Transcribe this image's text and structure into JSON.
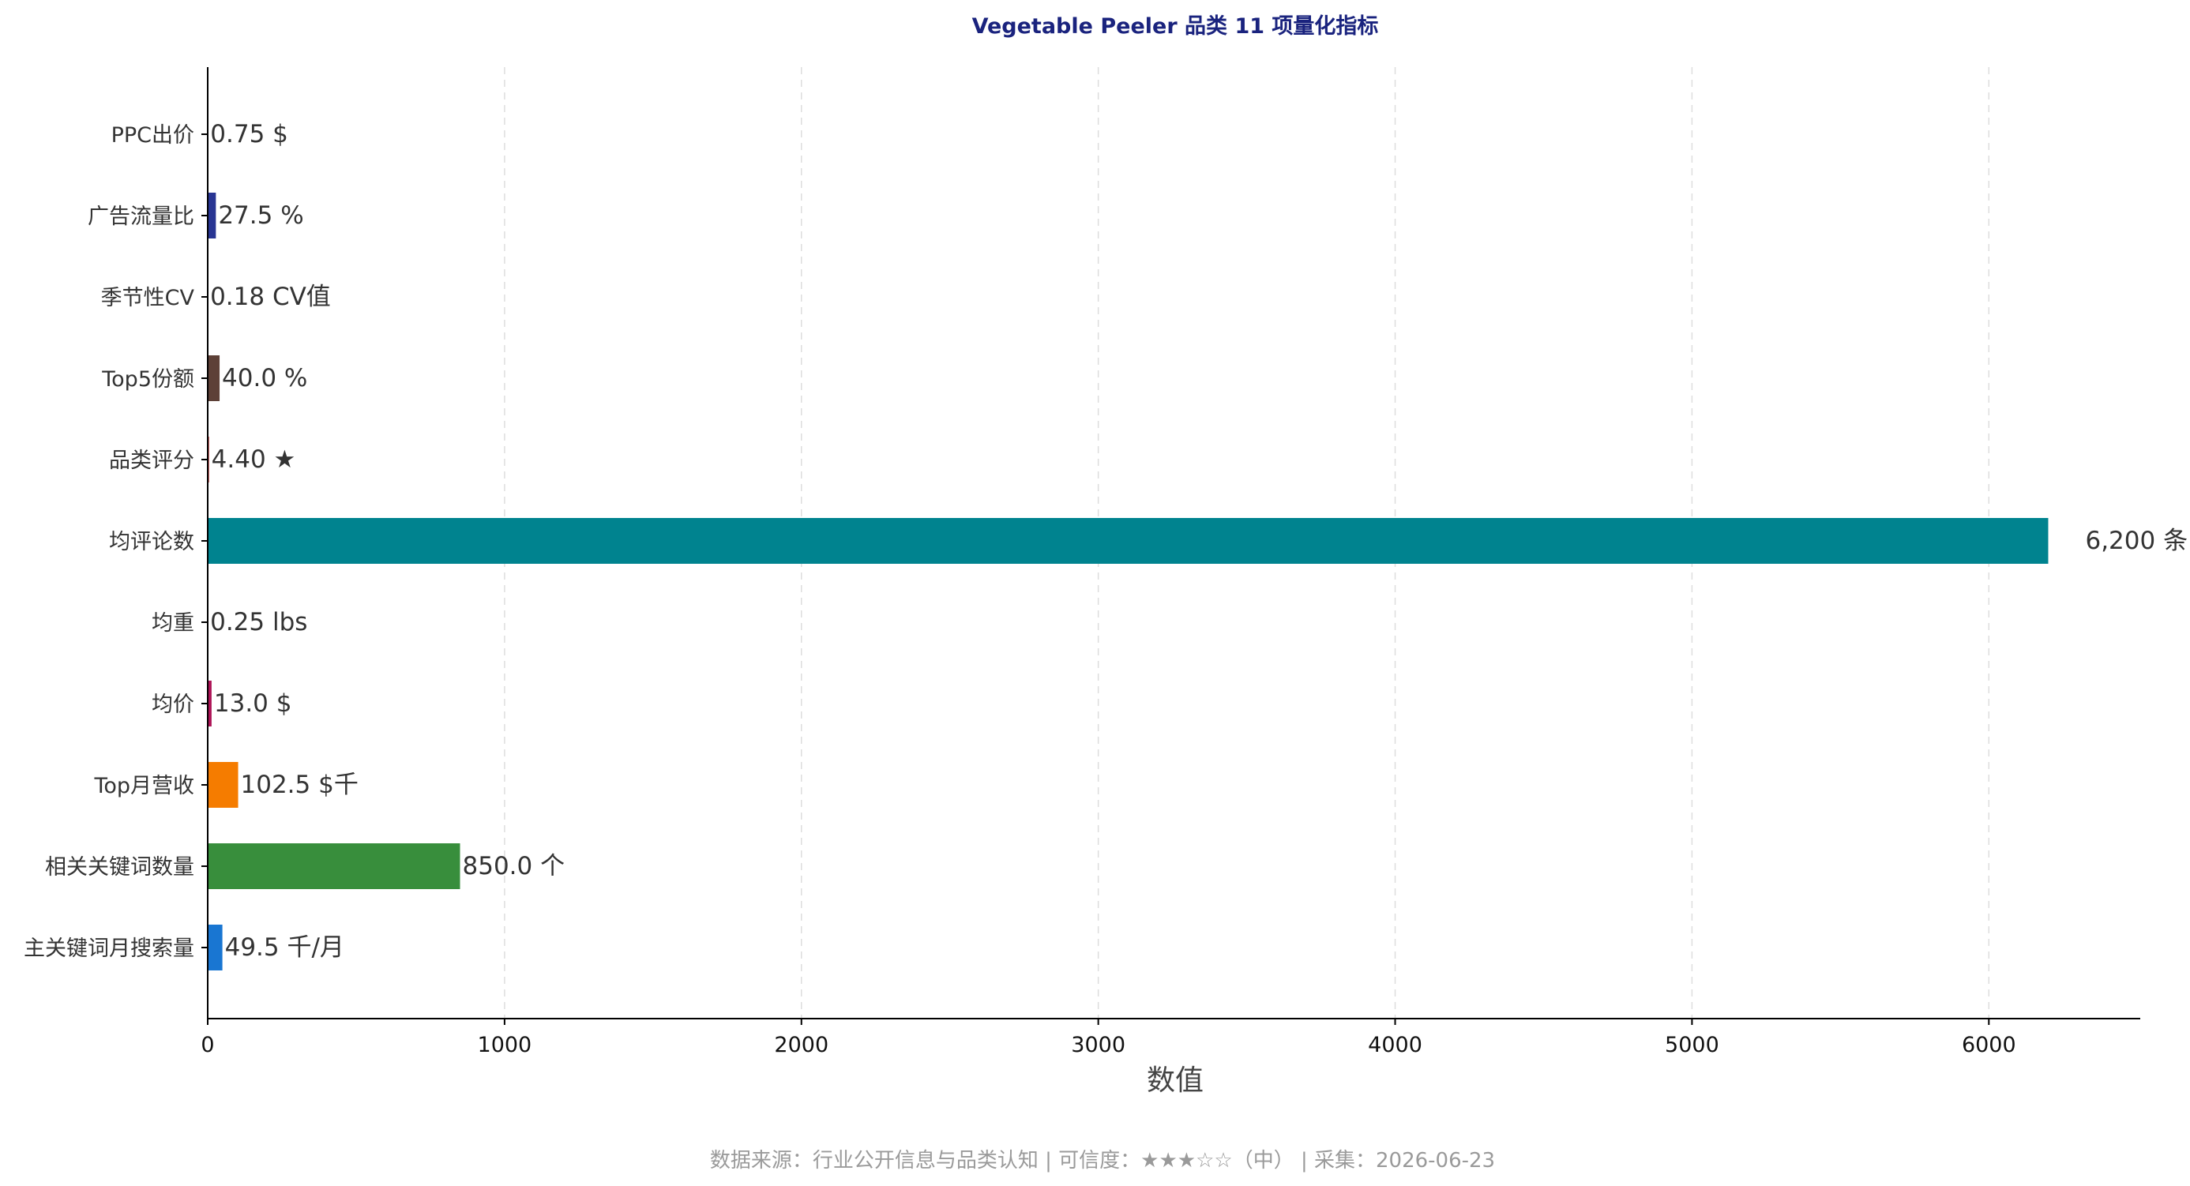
{
  "chart_data": {
    "type": "bar",
    "orientation": "horizontal",
    "title": "Vegetable Peeler 品类 11 项量化指标",
    "xlabel": "数值",
    "ylabel": "",
    "xlim": [
      0,
      6510
    ],
    "xticks": [
      0,
      1000,
      2000,
      3000,
      4000,
      5000,
      6000
    ],
    "grid": "x-dashed",
    "categories": [
      "PPC出价",
      "广告流量比",
      "季节性CV",
      "Top5份额",
      "品类评分",
      "均评论数",
      "均重",
      "均价",
      "Top月营收",
      "相关关键词数量",
      "主关键词月搜索量"
    ],
    "values": [
      0.75,
      27.5,
      0.18,
      40.0,
      4.4,
      6200,
      0.25,
      13.0,
      102.5,
      850.0,
      49.5
    ],
    "value_labels": [
      "0.75 $",
      "27.5 %",
      "0.18 CV值",
      "40.0 %",
      "4.40 ★",
      "6,200 条",
      "0.25 lbs",
      "13.0 $",
      "102.5 $千",
      "850.0 个",
      "49.5 千/月"
    ],
    "colors": [
      "#e64a19",
      "#283593",
      "#00897b",
      "#5d4037",
      "#c62828",
      "#00838f",
      "#546e7a",
      "#ad1457",
      "#f57c00",
      "#388e3c",
      "#1976d2"
    ]
  },
  "footer": "数据来源：行业公开信息与品类认知 | 可信度：★★★☆☆（中） | 采集：2026-06-23"
}
